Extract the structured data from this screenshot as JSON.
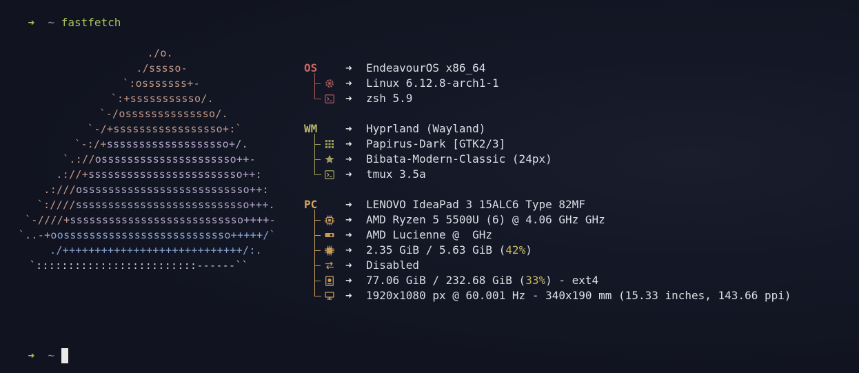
{
  "command_line": {
    "arrow": "➜",
    "dir": "~",
    "command": "fastfetch"
  },
  "bottom_prompt": {
    "arrow": "➜",
    "dir": "~"
  },
  "logo_lines": [
    [
      {
        "t": "./o.",
        "c": "lg"
      }
    ],
    [
      {
        "t": "./sssso-",
        "c": "lg"
      }
    ],
    [
      {
        "t": "`:osssssss+-",
        "c": "lg"
      }
    ],
    [
      {
        "t": "`:+sssssssssso/.",
        "c": "lg"
      }
    ],
    [
      {
        "t": "`-/ossssssssssssso/.",
        "c": "lg"
      }
    ],
    [
      {
        "t": "`-/+sssssssssssssssso+:`",
        "c": "lg"
      }
    ],
    [
      {
        "t": "`-:/+",
        "c": "lg"
      },
      {
        "t": "sssssssssssssssssso+/.",
        "c": "lp"
      }
    ],
    [
      {
        "t": "`.://",
        "c": "lg"
      },
      {
        "t": "osssssssssssssssssssso++-",
        "c": "lp"
      }
    ],
    [
      {
        "t": ".://+",
        "c": "lg"
      },
      {
        "t": "ssssssssssssssssssssssso++:",
        "c": "lp"
      }
    ],
    [
      {
        "t": ".:///",
        "c": "lg"
      },
      {
        "t": "ossssssssssssssssssssssssso++:",
        "c": "lp"
      }
    ],
    [
      {
        "t": "`:////",
        "c": "lg"
      },
      {
        "t": "sssssssssssssssssssssssssso+++.",
        "c": "lp"
      }
    ],
    [
      {
        "t": "`-////+",
        "c": "lg"
      },
      {
        "t": "sssssssssssssssssssssssssso++++-",
        "c": "lp"
      }
    ],
    [
      {
        "t": "`..-+",
        "c": "lg"
      },
      {
        "t": "oossssssssssssssssssssssssso+++++/`",
        "c": "lb"
      }
    ],
    [
      {
        "t": "./++++++++++++++++++++++++++++/:.",
        "c": "lb"
      }
    ],
    [
      {
        "t": "`:::::::::::::::::::::::::------``",
        "c": "lw"
      }
    ]
  ],
  "sections": [
    {
      "key": "OS",
      "group": "os",
      "main": "EndeavourOS x86_64",
      "rows": [
        {
          "icon": "gear-icon",
          "value": "Linux 6.12.8-arch1-1"
        },
        {
          "icon": "terminal-icon",
          "value": "zsh 5.9"
        }
      ]
    },
    {
      "key": "WM",
      "group": "wm",
      "main": "Hyprland (Wayland)",
      "rows": [
        {
          "icon": "grid-icon",
          "value": "Papirus-Dark [GTK2/3]"
        },
        {
          "icon": "star-icon",
          "value": "Bibata-Modern-Classic (24px)"
        },
        {
          "icon": "terminal-icon",
          "value": "tmux 3.5a"
        }
      ]
    },
    {
      "key": "PC",
      "group": "pc",
      "main": "LENOVO IdeaPad 3 15ALC6 Type 82MF",
      "rows": [
        {
          "icon": "cpu-icon",
          "value": "AMD Ryzen 5 5500U (6) @ 4.06 GHz GHz"
        },
        {
          "icon": "gpu-icon",
          "value": "AMD Lucienne @  GHz"
        },
        {
          "icon": "memory-icon",
          "value": "2.35 GiB / 5.63 GiB (",
          "pct": "42%",
          "suffix": ")"
        },
        {
          "icon": "swap-icon",
          "value": "Disabled"
        },
        {
          "icon": "disk-icon",
          "value": "77.06 GiB / 232.68 GiB (",
          "pct": "33%",
          "suffix": ") - ext4"
        },
        {
          "icon": "monitor-icon",
          "value": "1920x1080 px @ 60.001 Hz - 340x190 mm (15.33 inches, 143.66 ppi)"
        }
      ]
    }
  ],
  "arrow_glyph": "➜"
}
